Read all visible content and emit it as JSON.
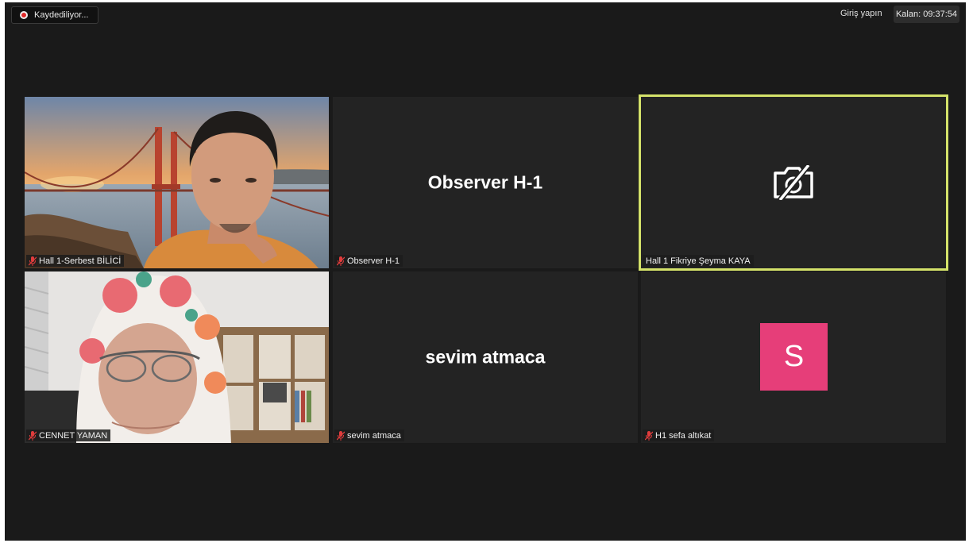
{
  "recording": {
    "label": "Kaydediliyor..."
  },
  "header": {
    "signin_label": "Giriş yapın",
    "timer_label": "Kalan: 09:37:54"
  },
  "participants": [
    {
      "name": "Hall 1-Serbest BİLİCİ",
      "muted": true,
      "video": "on"
    },
    {
      "name": "Observer H-1",
      "display_name": "Observer H-1",
      "muted": true,
      "video": "off"
    },
    {
      "name": "Hall 1 Fikriye Şeyma KAYA",
      "muted": false,
      "video": "camera-off",
      "active_speaker": true
    },
    {
      "name": "CENNET YAMAN",
      "muted": true,
      "video": "on"
    },
    {
      "name": "sevim atmaca",
      "display_name": "sevim atmaca",
      "muted": true,
      "video": "off"
    },
    {
      "name": "H1 sefa altıkat",
      "avatar_letter": "S",
      "avatar_color": "#e63e79",
      "muted": true,
      "video": "off"
    }
  ],
  "colors": {
    "active_speaker_border": "#d4e26a",
    "muted_icon": "#e03c3c"
  }
}
